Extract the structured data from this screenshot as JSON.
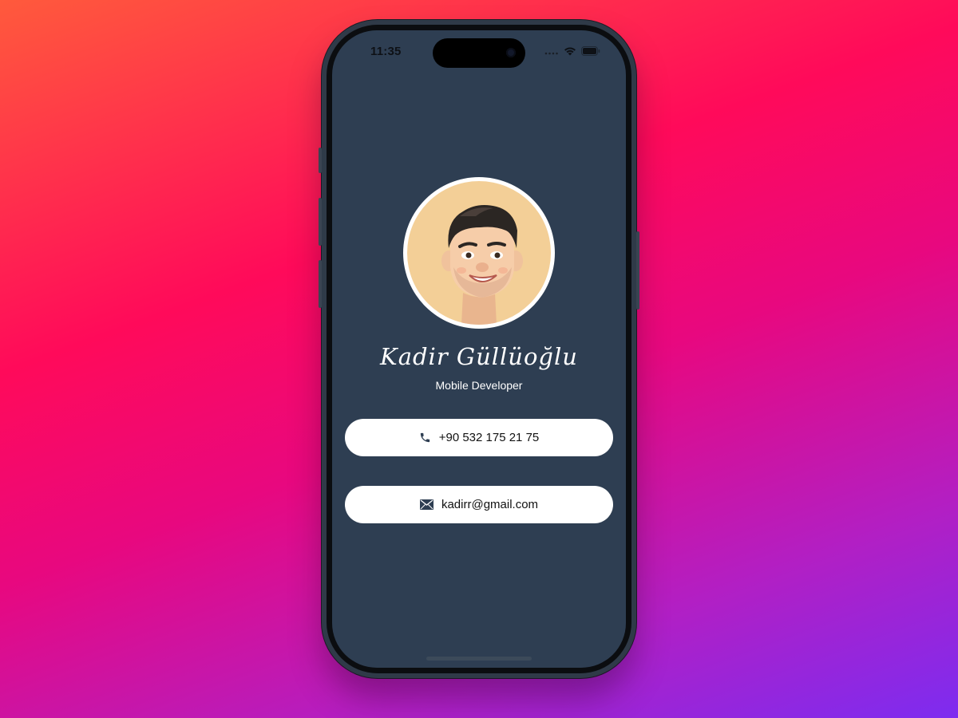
{
  "status_bar": {
    "time": "11:35",
    "icons": [
      "cellular-dots-icon",
      "wifi-icon",
      "battery-icon"
    ]
  },
  "profile": {
    "name": "Kadir Güllüoğlu",
    "title": "Mobile Developer",
    "avatar": "memoji-avatar"
  },
  "contacts": [
    {
      "icon": "phone-icon",
      "label": "+90 532 175 21 75"
    },
    {
      "icon": "mail-icon",
      "label": "kadirr@gmail.com"
    }
  ],
  "colors": {
    "screen_background": "#2e3e52",
    "avatar_background": "#f3cf97",
    "card_background": "#ffffff",
    "icon_color": "#2e3e52"
  }
}
